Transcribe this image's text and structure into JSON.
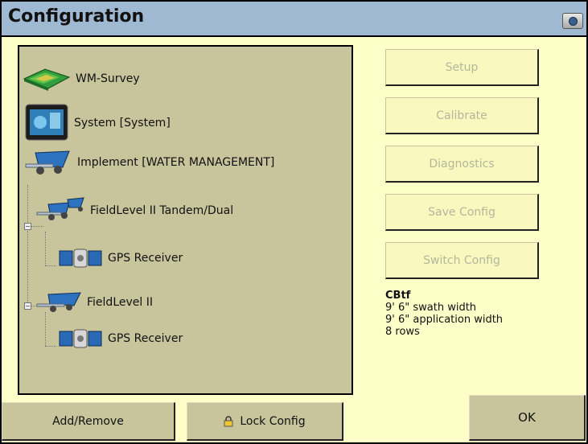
{
  "window": {
    "title": "Configuration"
  },
  "tree": {
    "items": [
      {
        "label": "WM-Survey",
        "icon": "terrain-map-icon"
      },
      {
        "label": "System [System]",
        "icon": "display-monitor-icon"
      },
      {
        "label": "Implement [WATER MANAGEMENT]",
        "icon": "implement-icon"
      },
      {
        "label": "FieldLevel II Tandem/Dual",
        "icon": "tandem-scraper-icon"
      },
      {
        "label": "GPS Receiver",
        "icon": "satellite-icon"
      },
      {
        "label": "FieldLevel II",
        "icon": "scraper-icon"
      },
      {
        "label": "GPS Receiver",
        "icon": "satellite-icon"
      }
    ]
  },
  "actions": {
    "setup": "Setup",
    "calibrate": "Calibrate",
    "diagnostics": "Diagnostics",
    "save_config": "Save Config",
    "switch_config": "Switch Config"
  },
  "info": {
    "title": "CBtf",
    "swath": "9' 6\" swath width",
    "application": "9' 6\" application width",
    "rows": "8 rows"
  },
  "bottom": {
    "add_remove": "Add/Remove",
    "lock_config": "Lock Config",
    "ok": "OK"
  },
  "colors": {
    "titlebar": "#9fb9d3",
    "background": "#fefec8",
    "panel": "#c8c49b",
    "disabled_text": "#b8b59b"
  }
}
